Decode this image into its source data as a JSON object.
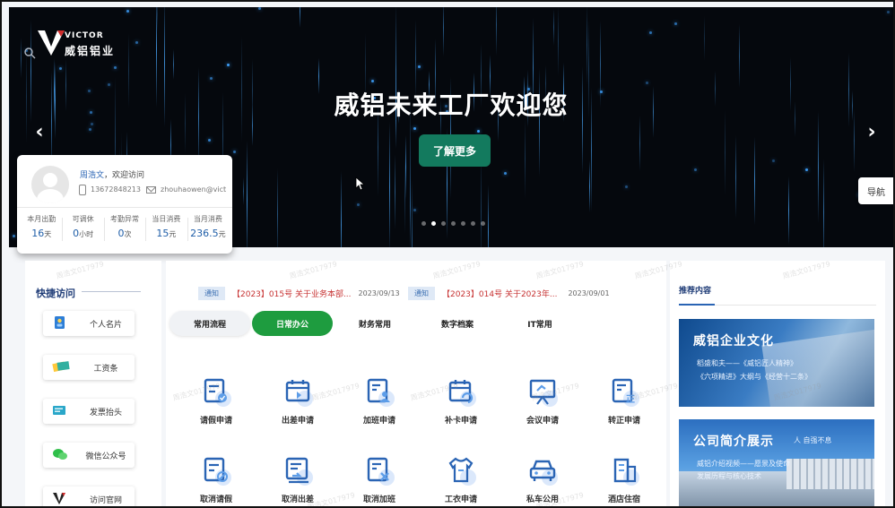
{
  "hero": {
    "logo_en": "VICTOR",
    "logo_cn": "威铝铝业",
    "title": "威铝未来工厂欢迎您",
    "cta": "了解更多",
    "prev": "‹",
    "next": "›",
    "slide_count": 7,
    "active_slide": 2
  },
  "nav_button": "导航",
  "user": {
    "name": "周浩文",
    "greeting_suffix": "，欢迎访问",
    "phone": "13672848213",
    "email": "zhouhaowen@vict",
    "stats": [
      {
        "label": "本月出勤",
        "value": "16",
        "unit": "天"
      },
      {
        "label": "可调休",
        "value": "0",
        "unit": "小时"
      },
      {
        "label": "考勤异常",
        "value": "0",
        "unit": "次"
      },
      {
        "label": "当日消费",
        "value": "15",
        "unit": "元"
      },
      {
        "label": "当月消费",
        "value": "236.5",
        "unit": "元"
      }
    ]
  },
  "quick_access": {
    "title": "快捷访问",
    "items": [
      {
        "label": "个人名片",
        "icon": "business-card-icon"
      },
      {
        "label": "工资条",
        "icon": "payslip-icon"
      },
      {
        "label": "发票抬头",
        "icon": "invoice-icon"
      },
      {
        "label": "微信公众号",
        "icon": "wechat-icon"
      },
      {
        "label": "访问官网",
        "icon": "victor-logo-icon"
      }
    ]
  },
  "notices": [
    {
      "tag": "通知",
      "text": "【2023】015号 关于业务本部...",
      "date": "2023/09/13"
    },
    {
      "tag": "通知",
      "text": "【2023】014号 关于2023年...",
      "date": "2023/09/01"
    }
  ],
  "tabs": [
    "常用流程",
    "日常办公",
    "财务常用",
    "数字档案",
    "IT常用"
  ],
  "active_tab": "日常办公",
  "apps": [
    {
      "label": "请假申请",
      "icon": "leave-request-icon"
    },
    {
      "label": "出差申请",
      "icon": "business-trip-icon"
    },
    {
      "label": "加班申请",
      "icon": "overtime-icon"
    },
    {
      "label": "补卡申请",
      "icon": "card-reissue-icon"
    },
    {
      "label": "会议申请",
      "icon": "meeting-icon"
    },
    {
      "label": "转正申请",
      "icon": "regularization-icon"
    },
    {
      "label": "取消请假",
      "icon": "cancel-leave-icon"
    },
    {
      "label": "取消出差",
      "icon": "cancel-trip-icon"
    },
    {
      "label": "取消加班",
      "icon": "cancel-overtime-icon"
    },
    {
      "label": "工衣申请",
      "icon": "uniform-icon"
    },
    {
      "label": "私车公用",
      "icon": "private-car-icon"
    },
    {
      "label": "酒店住宿",
      "icon": "hotel-icon"
    }
  ],
  "recommend": {
    "title": "推荐内容",
    "items": [
      {
        "title": "威铝企业文化",
        "lines": [
          "稻盛和夫——《威铝匠人精神》",
          "《六项精进》大纲与《经营十二条》"
        ]
      },
      {
        "title": "公司简介展示",
        "lines": [
          "威铝介绍视频——愿景及使命",
          "发展历程与核心技术"
        ],
        "badge": "人    自强不息"
      }
    ]
  },
  "watermark": "周浩文017979",
  "colors": {
    "accent": "#1e9c3f",
    "brand_green": "#137a5e",
    "primary_blue": "#2a64b4",
    "notice_red": "#c73232"
  }
}
